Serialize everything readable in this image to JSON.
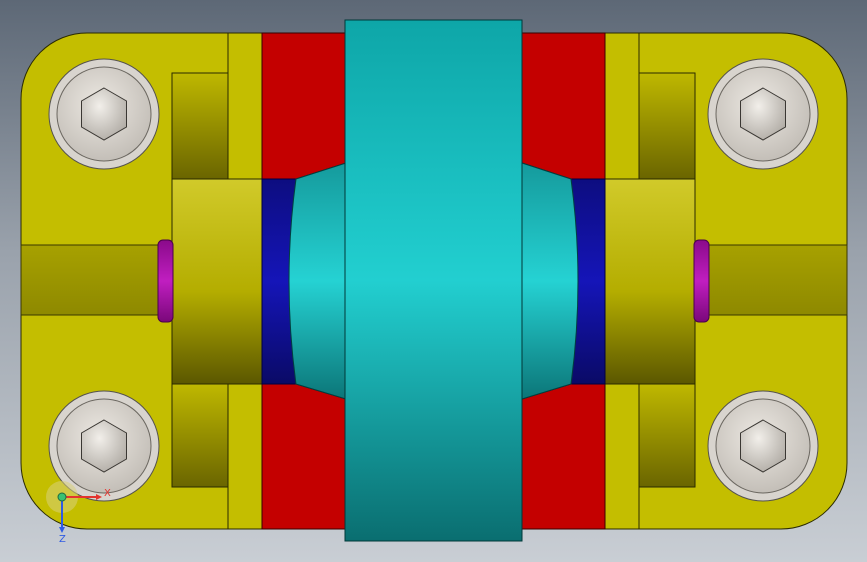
{
  "viewport": {
    "type": "cad-3d-viewport",
    "view": "top"
  },
  "triad": {
    "x_label": "X",
    "z_label": "Z",
    "x_color": "#e3342f",
    "y_color": "#38c172",
    "z_color": "#2f5be3"
  },
  "parts": [
    {
      "name": "base-plate",
      "color": "#c4be00"
    },
    {
      "name": "left-clamp-block",
      "color": "#c4be00"
    },
    {
      "name": "right-clamp-block",
      "color": "#c4be00"
    },
    {
      "name": "red-jaw-blocks",
      "color": "#c40000"
    },
    {
      "name": "center-hub",
      "color": "#13b5b5"
    },
    {
      "name": "blue-spacers",
      "color": "#10109a"
    },
    {
      "name": "magenta-pins",
      "color": "#b010b0"
    },
    {
      "name": "socket-head-screws",
      "color": "#cfcac4",
      "count": 4
    }
  ]
}
